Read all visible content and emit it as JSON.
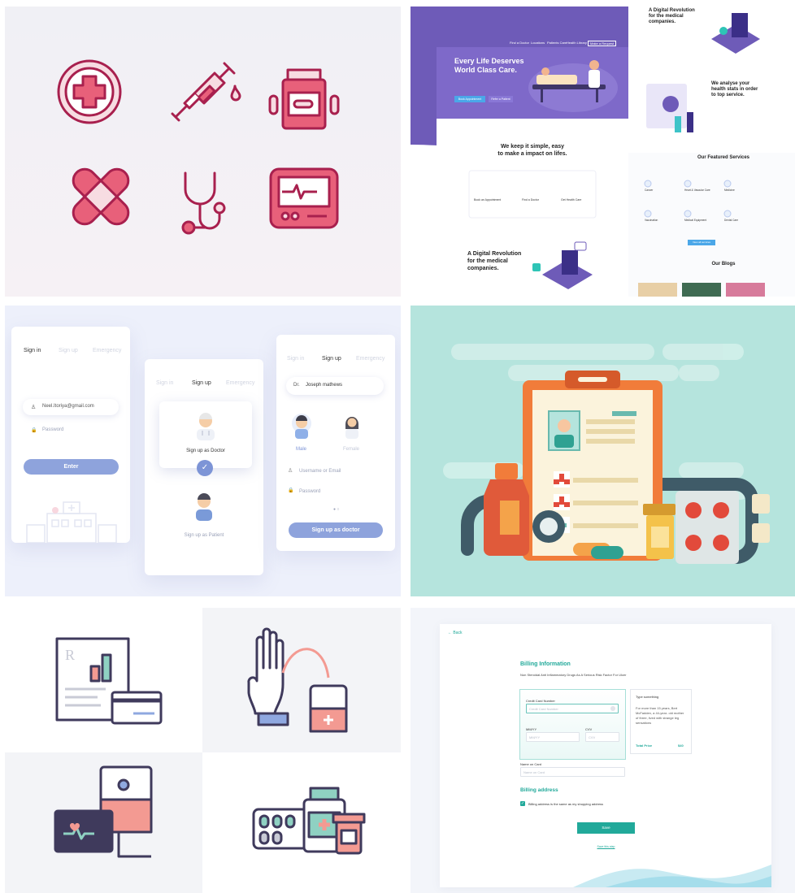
{
  "web": {
    "nav": [
      "Find a Doctor",
      "Locations",
      "Patients Care",
      "Health Library",
      "Make a Request"
    ],
    "hero_title_1": "Every Life Deserves",
    "hero_title_2": "World Class Care.",
    "hero_button_primary": "Book Appointment",
    "hero_button_secondary": "Refer a Patient",
    "simple_title_1": "We keep it simple, easy",
    "simple_title_2": "to make a impact on lifes.",
    "steps": [
      "Book an Appointment",
      "Find a Doctor",
      "Get Health Care"
    ],
    "revolution_title_1": "A Digital Revolution",
    "revolution_title_2": "for the medical",
    "revolution_title_3": "companies.",
    "right_revolution_1": "A Digital Revolution",
    "right_revolution_2": "for the medical",
    "right_revolution_3": "companies.",
    "analyse_1": "We analyse your",
    "analyse_2": "health stats in order",
    "analyse_3": "to top service.",
    "featured_title": "Our Featured Services",
    "services": [
      "Cancer",
      "Heart & Vascular Care",
      "Medicine",
      "Vaccination",
      "Medical Equipment",
      "Dental Care"
    ],
    "view_all": "View all services",
    "blogs_title": "Our Blogs"
  },
  "auth": {
    "signin_card": {
      "tabs": [
        "Sign in",
        "Sign up",
        "Emergency"
      ],
      "email_value": "Neel.Itoriya@gmail.com",
      "password_placeholder": "Password",
      "enter_label": "Enter"
    },
    "signup_card": {
      "tabs": [
        "Sign in",
        "Sign up",
        "Emergency"
      ],
      "doctor_label": "Sign up as Doctor",
      "patient_label": "Sign up as Patient"
    },
    "doctor_form": {
      "tabs": [
        "Sign in",
        "Sign up",
        "Emergency"
      ],
      "prefix": "Dr.",
      "name_value": "Joseph mathews",
      "male_label": "Male",
      "female_label": "Female",
      "username_placeholder": "Username or Email",
      "password_placeholder": "Password",
      "submit_label": "Sign up as doctor"
    }
  },
  "billing": {
    "back_label": "Back",
    "title": "Billing Information",
    "subtitle": "Non Steroidal Anti Inflammatory Drugs As A Serious Risk Factor For Ulcer",
    "card_number_label": "Credit Card Number",
    "card_number_placeholder": "Credit Card Number",
    "mmyy_label": "MM/YY",
    "mmyy_placeholder": "MM/YY",
    "cvv_label": "CVV",
    "cvv_placeholder": "CVV",
    "summary_title": "Type something",
    "summary_body": "For more than 15 years, Bert McFadden, a 44-year- old mother of three, lived with strange leg sensations",
    "total_label": "Total Price",
    "total_value": "$40",
    "name_label": "Name on Card",
    "name_placeholder": "Name on Card",
    "address_title": "Billing address",
    "same_address_label": "Billing address is the same as my shopping address",
    "save_label": "Save",
    "save_later": "Save this step"
  },
  "colors": {
    "icon_stroke": "#a8204e",
    "icon_pink": "#e8607a",
    "purple": "#6e5bb8",
    "auth_button": "#8ea3dc",
    "teal": "#21a99a",
    "clip_bg": "#b5e4dd"
  }
}
